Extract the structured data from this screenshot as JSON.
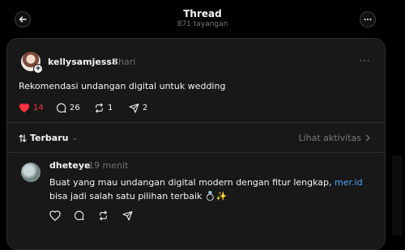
{
  "header": {
    "title": "Thread",
    "views": "871 tayangan"
  },
  "post": {
    "username": "kellysamjess8",
    "time": "1hari",
    "text": "Rekomendasi undangan digital untuk wedding",
    "likes": "14",
    "comments": "26",
    "reposts": "1",
    "shares": "2",
    "liked_color": "#ff3040"
  },
  "sort": {
    "label": "Terbaru",
    "activity_label": "Lihat aktivitas"
  },
  "reply": {
    "username": "dheteye",
    "time": "19 menit",
    "text_before_link": "Buat yang mau undangan digital modern dengan fitur lengkap, ",
    "link_text": "mer.id",
    "text_after_link": " bisa jadi salah satu pilihan terbaik 💍✨"
  },
  "icons": {
    "back": "arrow-left-icon",
    "more": "ellipsis-icon",
    "like": "heart-icon",
    "comment": "comment-icon",
    "repost": "repost-icon",
    "share": "send-icon",
    "sort": "sort-arrows-icon"
  },
  "colors": {
    "background": "#000000",
    "card": "#181818",
    "link": "#4aa3ff",
    "like": "#ff3040"
  }
}
